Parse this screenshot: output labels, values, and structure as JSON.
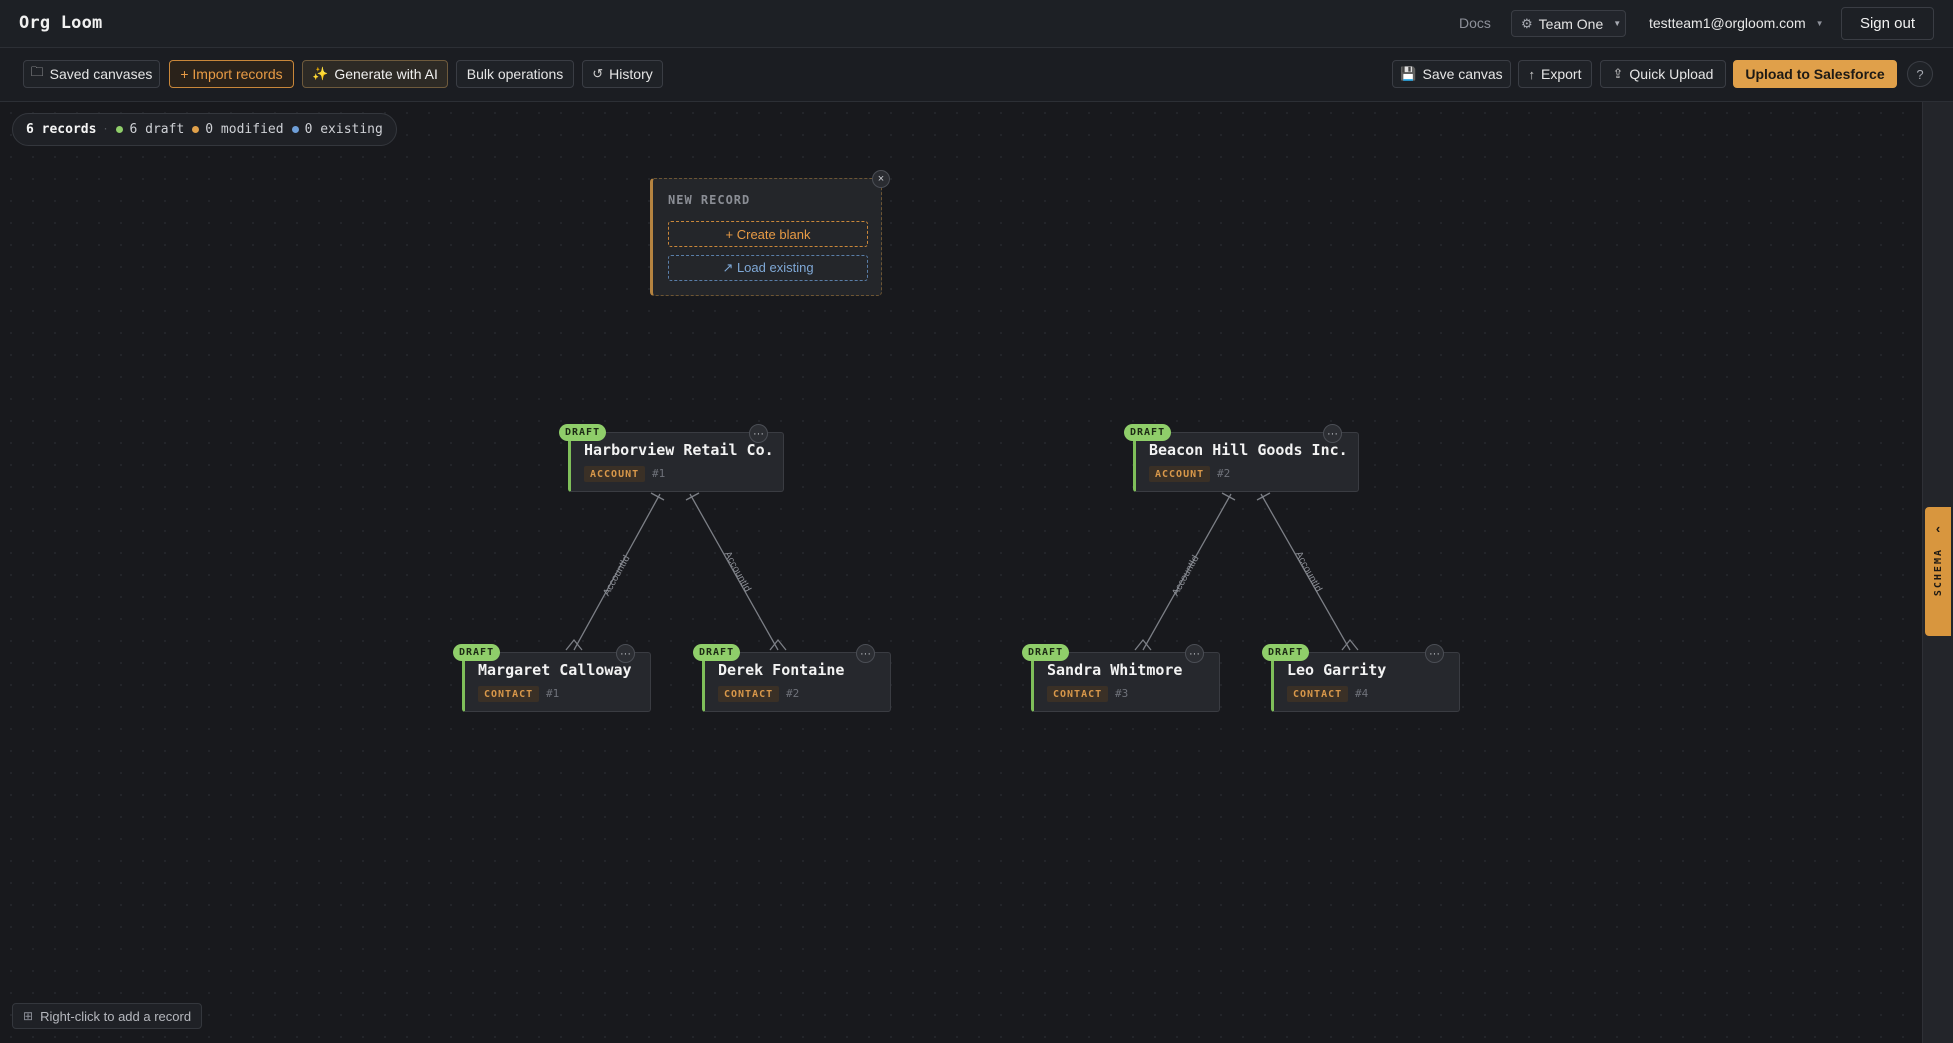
{
  "header": {
    "logo": "Org Loom",
    "docs": "Docs",
    "team": "Team One",
    "user_email": "testteam1@orgloom.com",
    "sign_out": "Sign out"
  },
  "toolbar": {
    "saved_canvases": "Saved canvases",
    "import_records": "+ Import records",
    "generate_ai": "Generate with AI",
    "bulk_operations": "Bulk operations",
    "history": "History",
    "save_canvas": "Save canvas",
    "export": "Export",
    "quick_upload": "Quick Upload",
    "upload_salesforce": "Upload to Salesforce",
    "help": "?"
  },
  "stats": {
    "total": "6 records",
    "draft": "6 draft",
    "modified": "0 modified",
    "existing": "0 existing",
    "colors": {
      "draft": "#8fce6a",
      "modified": "#e0a04a",
      "existing": "#6f9fd8"
    }
  },
  "new_record": {
    "title": "NEW RECORD",
    "create_blank": "+ Create blank",
    "load_existing": "↗ Load existing",
    "close": "×"
  },
  "nodes": [
    {
      "name": "Harborview Retail Co.",
      "type": "ACCOUNT",
      "num": "#1",
      "status": "DRAFT"
    },
    {
      "name": "Beacon Hill Goods Inc.",
      "type": "ACCOUNT",
      "num": "#2",
      "status": "DRAFT"
    },
    {
      "name": "Margaret Calloway",
      "type": "CONTACT",
      "num": "#1",
      "status": "DRAFT"
    },
    {
      "name": "Derek Fontaine",
      "type": "CONTACT",
      "num": "#2",
      "status": "DRAFT"
    },
    {
      "name": "Sandra Whitmore",
      "type": "CONTACT",
      "num": "#3",
      "status": "DRAFT"
    },
    {
      "name": "Leo Garrity",
      "type": "CONTACT",
      "num": "#4",
      "status": "DRAFT"
    }
  ],
  "edge_label": "AccountId",
  "schema_tab": "SCHEMA",
  "hint": "Right-click to add a record",
  "accent": "#e0a04a"
}
